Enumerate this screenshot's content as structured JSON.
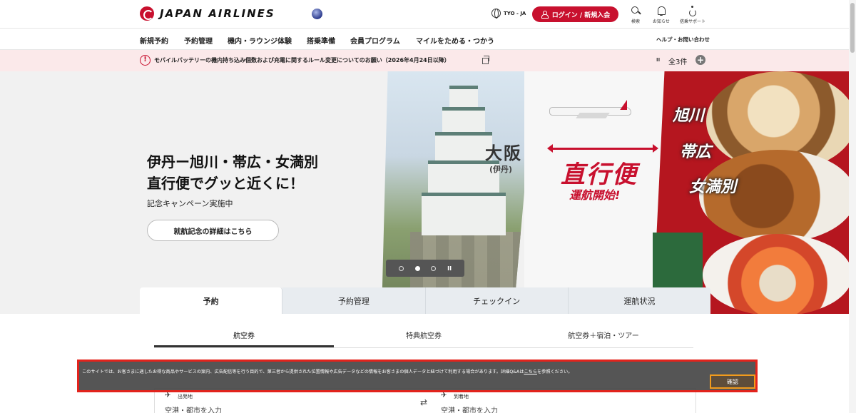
{
  "header": {
    "logo_text": "JAPAN AIRLINES",
    "lang": "TYO - JA",
    "login_label": "ログイン / 新規入会",
    "tools": [
      {
        "label": "検索",
        "icon": "search-icon"
      },
      {
        "label": "お知らせ",
        "icon": "bell-icon"
      },
      {
        "label": "搭乗サポート",
        "icon": "accessibility-icon"
      }
    ]
  },
  "nav": {
    "items": [
      "新規予約",
      "予約管理",
      "機内・ラウンジ体験",
      "搭乗準備",
      "会員プログラム",
      "マイルをためる・つかう"
    ],
    "help": "ヘルプ・お問い合わせ"
  },
  "notice": {
    "text": "モバイルバッテリーの機内持ち込み個数および充電に関するルール変更についてのお願い（2026年4月24日以降）",
    "count": "全3件"
  },
  "hero": {
    "title_line1": "伊丹ー旭川・帯広・女満別",
    "title_line2": "直行便でグッと近くに！",
    "subtitle": "記念キャンペーン実施中",
    "button": "就航記念の詳細はこちら",
    "osaka": "大阪",
    "itami": "(伊丹)",
    "direct": "直行便",
    "service_start": "運航開始!",
    "cities": [
      "旭川",
      "帯広",
      "女満別"
    ]
  },
  "booking": {
    "tabs": [
      "予約",
      "予約管理",
      "チェックイン",
      "運航状況"
    ],
    "subtabs": [
      "航空券",
      "特典航空券",
      "航空券＋宿泊・ツアー"
    ],
    "departure_label": "出発地",
    "departure_placeholder": "空港・都市を入力",
    "arrival_label": "到着地",
    "arrival_placeholder": "空港・都市を入力"
  },
  "cookie": {
    "text": "このサイトでは、お客さまに適したお得な商品やサービスの案内、広告配信等を行う目的で、第三者から提供された位置情報や広告データなどの情報をお客さまの個人データと紐づけて利用する場合があります。詳細Q&Aは",
    "link": "こちら",
    "text_after": "を参照ください。",
    "confirm": "確認"
  },
  "colors": {
    "brand_red": "#c8102e",
    "notice_bg": "#fbe9ea",
    "highlight_border": "#e3231c",
    "confirm_border": "#f29b1c"
  }
}
